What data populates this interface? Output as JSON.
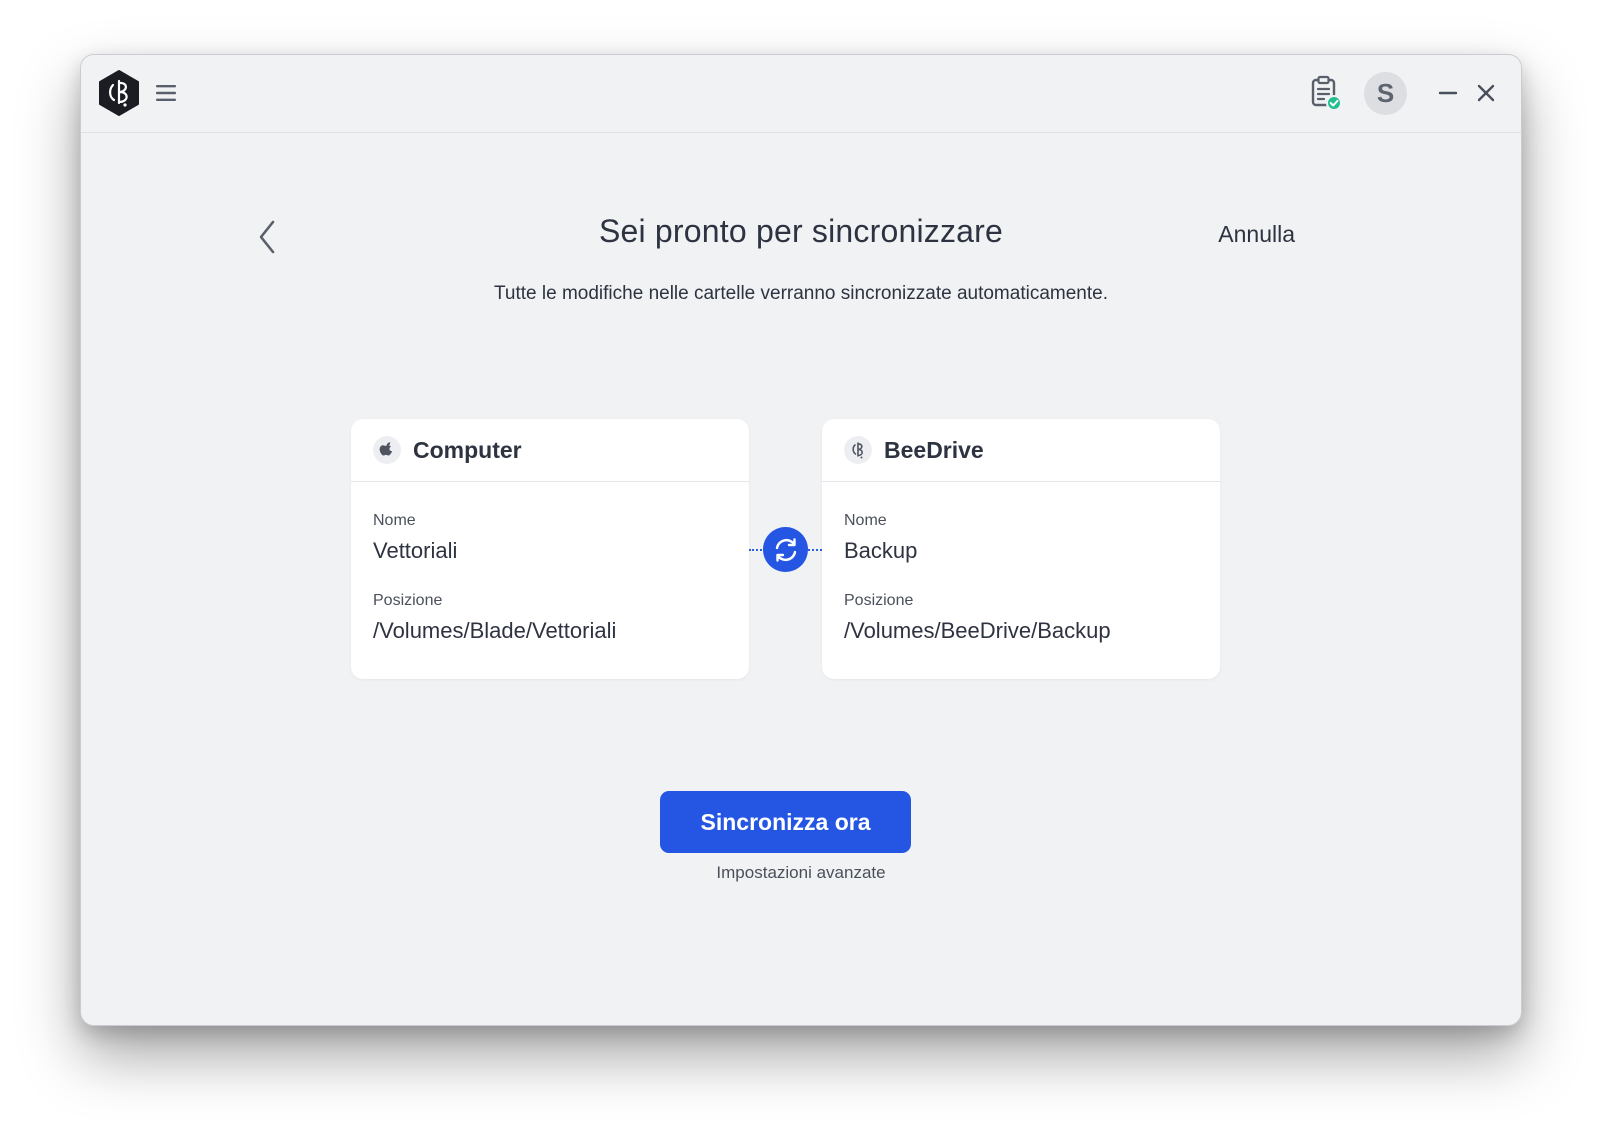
{
  "header": {
    "avatar_initial": "S"
  },
  "page": {
    "title": "Sei pronto per sincronizzare",
    "subtitle": "Tutte le modifiche nelle cartelle verranno sincronizzate automaticamente.",
    "cancel_label": "Annulla"
  },
  "source_card": {
    "title": "Computer",
    "icon": "apple-icon",
    "name_label": "Nome",
    "name_value": "Vettoriali",
    "location_label": "Posizione",
    "location_value": "/Volumes/Blade/Vettoriali"
  },
  "destination_card": {
    "title": "BeeDrive",
    "icon": "beedrive-icon",
    "name_label": "Nome",
    "name_value": "Backup",
    "location_label": "Posizione",
    "location_value": "/Volumes/BeeDrive/Backup"
  },
  "actions": {
    "sync_now_label": "Sincronizza ora",
    "advanced_settings_label": "Impostazioni avanzate"
  },
  "colors": {
    "accent": "#2456e3",
    "background": "#f1f2f4",
    "card": "#ffffff",
    "status_ok": "#1fbf8f"
  }
}
